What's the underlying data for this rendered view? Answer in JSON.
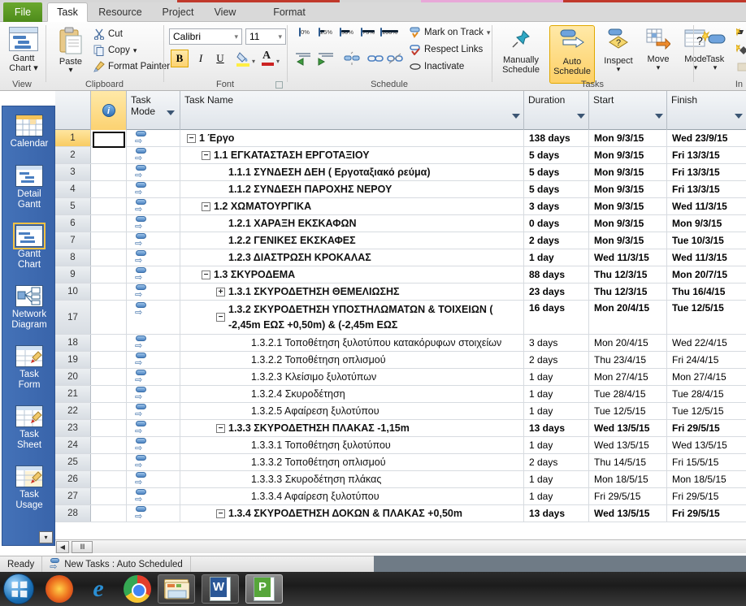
{
  "window": {
    "tabs": [
      {
        "label": "File",
        "name": "tab-file"
      },
      {
        "label": "Task",
        "name": "tab-task"
      },
      {
        "label": "Resource",
        "name": "tab-resource"
      },
      {
        "label": "Project",
        "name": "tab-project"
      },
      {
        "label": "View",
        "name": "tab-view"
      },
      {
        "label": "Format",
        "name": "tab-format"
      }
    ],
    "active_tab": "Task"
  },
  "ribbon": {
    "groups": [
      {
        "label": "View"
      },
      {
        "label": "Clipboard"
      },
      {
        "label": "Font"
      },
      {
        "label": "Schedule"
      },
      {
        "label": "Tasks"
      },
      {
        "label": "In"
      }
    ],
    "view": {
      "gantt_chart": "Gantt\nChart",
      "gantt_chart_line1": "Gantt",
      "gantt_chart_line2": "Chart",
      "dropdown_caret": "▾"
    },
    "clipboard": {
      "paste": "Paste",
      "paste_caret": "▾",
      "cut": "Cut",
      "copy": "Copy",
      "copy_caret": "▾",
      "format_painter": "Format Painter"
    },
    "font": {
      "font_family_value": "Calibri",
      "font_size_value": "11",
      "bold": "B",
      "italic": "I",
      "underline": "U",
      "caret": "▾",
      "highlight_letter": "A",
      "font_color_letter": "A",
      "dialog_launcher": "◢"
    },
    "schedule": {
      "pct_0": "0%",
      "pct_25": "25%",
      "pct_50": "50%",
      "pct_75": "75%",
      "pct_100": "100%",
      "mark_on_track": "Mark on Track",
      "mark_on_track_caret": "▾",
      "respect_links": "Respect Links",
      "inactivate": "Inactivate"
    },
    "tasks": {
      "manually_schedule_l1": "Manually",
      "manually_schedule_l2": "Schedule",
      "auto_schedule_l1": "Auto",
      "auto_schedule_l2": "Schedule",
      "inspect": "Inspect",
      "move": "Move",
      "mode": "Mode",
      "caret": "▾"
    },
    "insert": {
      "task": "Task",
      "caret": "▾"
    }
  },
  "viewbar": {
    "items": [
      {
        "l1": "Calendar",
        "l2": "",
        "icon": "calendar-icon",
        "selected": false
      },
      {
        "l1": "Detail",
        "l2": "Gantt",
        "icon": "detail-gantt-icon",
        "selected": false
      },
      {
        "l1": "Gantt",
        "l2": "Chart",
        "icon": "gantt-chart-icon",
        "selected": true
      },
      {
        "l1": "Network",
        "l2": "Diagram",
        "icon": "network-diagram-icon",
        "selected": false
      },
      {
        "l1": "Task",
        "l2": "Form",
        "icon": "task-form-icon",
        "selected": false
      },
      {
        "l1": "Task",
        "l2": "Sheet",
        "icon": "task-sheet-icon",
        "selected": false
      },
      {
        "l1": "Task",
        "l2": "Usage",
        "icon": "task-usage-icon",
        "selected": false
      }
    ],
    "scroll_down_caret": "▾"
  },
  "grid": {
    "columns": [
      {
        "label": "",
        "name": "column-id"
      },
      {
        "label": "",
        "name": "column-indicators"
      },
      {
        "label": "Task Mode",
        "name": "column-task-mode",
        "l1": "Task",
        "l2": "Mode"
      },
      {
        "label": "Task Name",
        "name": "column-task-name"
      },
      {
        "label": "Duration",
        "name": "column-duration"
      },
      {
        "label": "Start",
        "name": "column-start"
      },
      {
        "label": "Finish",
        "name": "column-finish"
      }
    ],
    "rows": [
      {
        "id": "1",
        "name": "1 Έργο",
        "indent": 0,
        "outline": "minus",
        "bold": true,
        "duration": "138 days",
        "start": "Mon 9/3/15",
        "finish": "Wed 23/9/15",
        "selected": true,
        "tall": false
      },
      {
        "id": "2",
        "name": "1.1 ΕΓΚΑΤΑΣΤΑΣΗ ΕΡΓΟΤΑΞΙΟΥ",
        "indent": 1,
        "outline": "minus",
        "bold": true,
        "duration": "5 days",
        "start": "Mon 9/3/15",
        "finish": "Fri 13/3/15",
        "selected": false,
        "tall": false
      },
      {
        "id": "3",
        "name": "1.1.1 ΣΥΝΔΕΣΗ ΔΕΗ ( Εργοταξιακό ρεύμα)",
        "indent": 2,
        "outline": "none",
        "bold": true,
        "duration": "5 days",
        "start": "Mon 9/3/15",
        "finish": "Fri 13/3/15",
        "selected": false,
        "tall": false
      },
      {
        "id": "4",
        "name": "1.1.2 ΣΥΝΔΕΣΗ ΠΑΡΟΧΗΣ ΝΕΡΟΥ",
        "indent": 2,
        "outline": "none",
        "bold": true,
        "duration": "5 days",
        "start": "Mon 9/3/15",
        "finish": "Fri 13/3/15",
        "selected": false,
        "tall": false
      },
      {
        "id": "5",
        "name": "1.2 ΧΩΜΑΤΟΥΡΓΙΚΑ",
        "indent": 1,
        "outline": "minus",
        "bold": true,
        "duration": "3 days",
        "start": "Mon 9/3/15",
        "finish": "Wed 11/3/15",
        "selected": false,
        "tall": false
      },
      {
        "id": "6",
        "name": "1.2.1 ΧΑΡΑΞΗ ΕΚΣΚΑΦΩΝ",
        "indent": 2,
        "outline": "none",
        "bold": true,
        "duration": "0 days",
        "start": "Mon 9/3/15",
        "finish": "Mon 9/3/15",
        "selected": false,
        "tall": false
      },
      {
        "id": "7",
        "name": "1.2.2 ΓΕΝΙΚΕΣ ΕΚΣΚΑΦΕΣ",
        "indent": 2,
        "outline": "none",
        "bold": true,
        "duration": "2 days",
        "start": "Mon 9/3/15",
        "finish": "Tue 10/3/15",
        "selected": false,
        "tall": false
      },
      {
        "id": "8",
        "name": "1.2.3 ΔΙΑΣΤΡΩΣΗ ΚΡΟΚΑΛΑΣ",
        "indent": 2,
        "outline": "none",
        "bold": true,
        "duration": "1 day",
        "start": "Wed 11/3/15",
        "finish": "Wed 11/3/15",
        "selected": false,
        "tall": false
      },
      {
        "id": "9",
        "name": "1.3 ΣΚΥΡΟΔΕΜΑ",
        "indent": 1,
        "outline": "minus",
        "bold": true,
        "duration": "88 days",
        "start": "Thu 12/3/15",
        "finish": "Mon 20/7/15",
        "selected": false,
        "tall": false
      },
      {
        "id": "10",
        "name": "1.3.1 ΣΚΥΡΟΔΕΤΗΣΗ ΘΕΜΕΛΙΩΣΗΣ",
        "indent": 2,
        "outline": "plus",
        "bold": true,
        "duration": "23 days",
        "start": "Thu 12/3/15",
        "finish": "Thu 16/4/15",
        "selected": false,
        "tall": false
      },
      {
        "id": "17",
        "name": "1.3.2 ΣΚΥΡΟΔΕΤΗΣΗ ΥΠΟΣΤΗΛΩΜΑΤΩΝ & ΤΟΙΧΕΙΩΝ ( -2,45m ΕΩΣ +0,50m) & (-2,45m ΕΩΣ",
        "indent": 2,
        "outline": "minus",
        "bold": true,
        "duration": "16 days",
        "start": "Mon 20/4/15",
        "finish": "Tue 12/5/15",
        "selected": false,
        "tall": true
      },
      {
        "id": "18",
        "name": "1.3.2.1 Τοποθέτηση ξυλοτύπου κατακόρυφων στοιχείων",
        "indent": 3,
        "outline": "none",
        "bold": false,
        "duration": "3 days",
        "start": "Mon 20/4/15",
        "finish": "Wed 22/4/15",
        "selected": false,
        "tall": false
      },
      {
        "id": "19",
        "name": "1.3.2.2 Τοποθέτηση οπλισμού",
        "indent": 3,
        "outline": "none",
        "bold": false,
        "duration": "2 days",
        "start": "Thu 23/4/15",
        "finish": "Fri 24/4/15",
        "selected": false,
        "tall": false
      },
      {
        "id": "20",
        "name": "1.3.2.3 Κλείσιμο ξυλοτύπων",
        "indent": 3,
        "outline": "none",
        "bold": false,
        "duration": "1 day",
        "start": "Mon 27/4/15",
        "finish": "Mon 27/4/15",
        "selected": false,
        "tall": false
      },
      {
        "id": "21",
        "name": "1.3.2.4 Σκυροδέτηση",
        "indent": 3,
        "outline": "none",
        "bold": false,
        "duration": "1 day",
        "start": "Tue 28/4/15",
        "finish": "Tue 28/4/15",
        "selected": false,
        "tall": false
      },
      {
        "id": "22",
        "name": "1.3.2.5 Αφαίρεση ξυλοτύπου",
        "indent": 3,
        "outline": "none",
        "bold": false,
        "duration": "1 day",
        "start": "Tue 12/5/15",
        "finish": "Tue 12/5/15",
        "selected": false,
        "tall": false
      },
      {
        "id": "23",
        "name": "1.3.3 ΣΚΥΡΟΔΕΤΗΣΗ ΠΛΑΚΑΣ -1,15m",
        "indent": 2,
        "outline": "minus",
        "bold": true,
        "duration": "13 days",
        "start": "Wed 13/5/15",
        "finish": "Fri 29/5/15",
        "selected": false,
        "tall": false
      },
      {
        "id": "24",
        "name": "1.3.3.1 Τοποθέτηση ξυλοτύπου",
        "indent": 3,
        "outline": "none",
        "bold": false,
        "duration": "1 day",
        "start": "Wed 13/5/15",
        "finish": "Wed 13/5/15",
        "selected": false,
        "tall": false
      },
      {
        "id": "25",
        "name": "1.3.3.2 Τοποθέτηση οπλισμού",
        "indent": 3,
        "outline": "none",
        "bold": false,
        "duration": "2 days",
        "start": "Thu 14/5/15",
        "finish": "Fri 15/5/15",
        "selected": false,
        "tall": false
      },
      {
        "id": "26",
        "name": "1.3.3.3 Σκυροδέτηση πλάκας",
        "indent": 3,
        "outline": "none",
        "bold": false,
        "duration": "1 day",
        "start": "Mon 18/5/15",
        "finish": "Mon 18/5/15",
        "selected": false,
        "tall": false
      },
      {
        "id": "27",
        "name": "1.3.3.4 Αφαίρεση ξυλοτύπου",
        "indent": 3,
        "outline": "none",
        "bold": false,
        "duration": "1 day",
        "start": "Fri 29/5/15",
        "finish": "Fri 29/5/15",
        "selected": false,
        "tall": false
      },
      {
        "id": "28",
        "name": "1.3.4 ΣΚΥΡΟΔΕΤΗΣΗ ΔΟΚΩΝ & ΠΛΑΚΑΣ +0,50m",
        "indent": 2,
        "outline": "minus",
        "bold": true,
        "duration": "13 days",
        "start": "Wed 13/5/15",
        "finish": "Fri 29/5/15",
        "selected": false,
        "tall": false
      }
    ]
  },
  "scrollbar": {
    "left_arrow": "◀",
    "thumb": "‖‖"
  },
  "statusbar": {
    "ready": "Ready",
    "new_tasks": "New Tasks : Auto Scheduled"
  },
  "taskbar": {
    "items": [
      {
        "name": "start-button",
        "label": ""
      },
      {
        "name": "firefox-icon",
        "label": ""
      },
      {
        "name": "internet-explorer-icon",
        "label": "e"
      },
      {
        "name": "google-chrome-icon",
        "label": ""
      },
      {
        "name": "file-explorer-taskbar-button",
        "label": ""
      },
      {
        "name": "word-taskbar-button",
        "label": ""
      },
      {
        "name": "project-taskbar-button",
        "label": ""
      }
    ]
  },
  "colors": {
    "accent_gold": "#fcd271",
    "ribbon_bg": "#f2f2f2",
    "viewbar_blue": "#3b6ab5",
    "file_tab_green": "#5c9c24"
  }
}
